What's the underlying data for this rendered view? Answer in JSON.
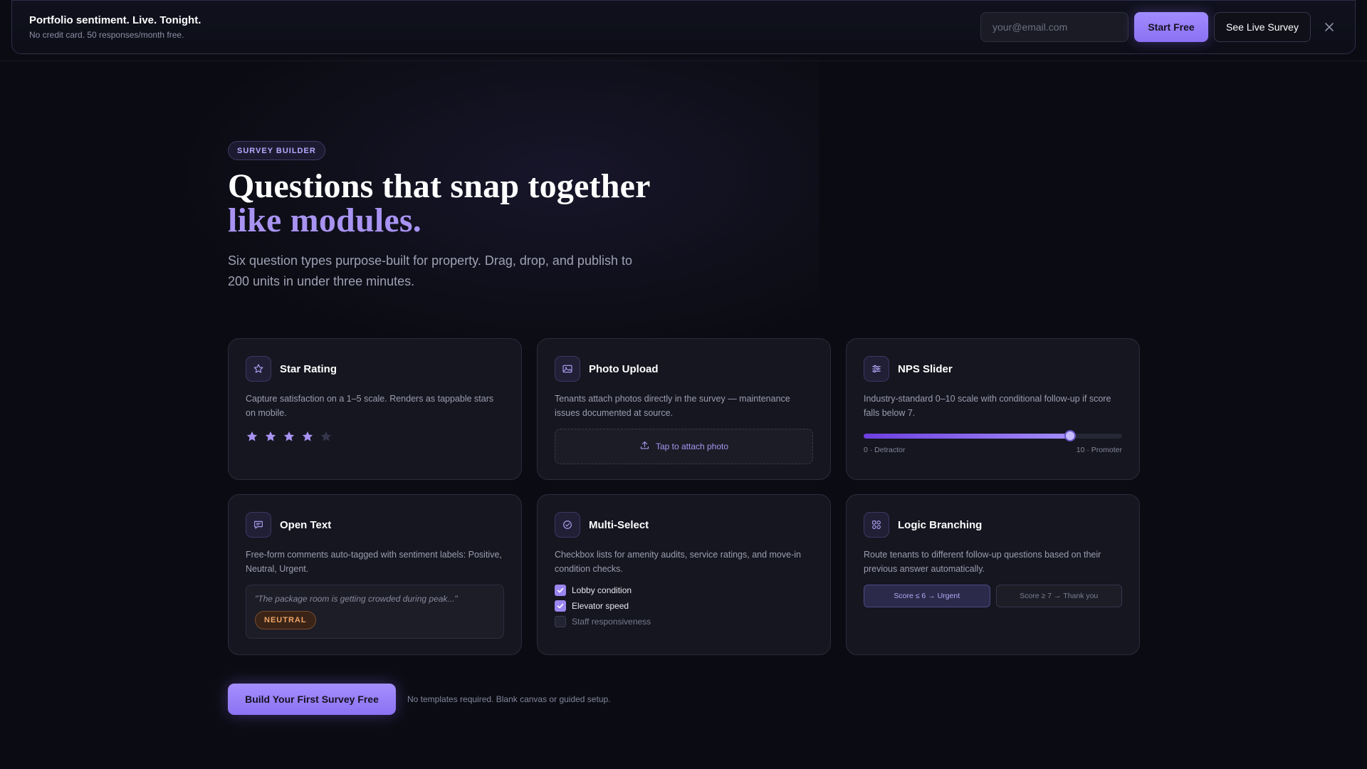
{
  "banner": {
    "title": "Portfolio sentiment. Live. Tonight.",
    "subtitle": "No credit card. 50 responses/month free.",
    "email_placeholder": "your@email.com",
    "start_label": "Start Free",
    "live_label": "See Live Survey",
    "close_icon": "close-icon"
  },
  "hero": {
    "badge": "SURVEY BUILDER",
    "headline_line1": "Questions that snap together",
    "headline_line2": "like modules.",
    "subhead": "Six question types purpose-built for property. Drag, drop, and publish to 200 units in under three minutes."
  },
  "cards": [
    {
      "icon": "star-icon",
      "title": "Star Rating",
      "desc": "Capture satisfaction on a 1–5 scale. Renders as tappable stars on mobile.",
      "rating": 4,
      "max_rating": 5
    },
    {
      "icon": "image-icon",
      "title": "Photo Upload",
      "desc": "Tenants attach photos directly in the survey — maintenance issues documented at source.",
      "upload_label": "Tap to attach photo",
      "upload_icon": "upload-icon"
    },
    {
      "icon": "sliders-icon",
      "title": "NPS Slider",
      "desc": "Industry-standard 0–10 scale with conditional follow-up if score falls below 7.",
      "value_fraction": 0.8,
      "min_label": "0 · Detractor",
      "max_label": "10 · Promoter"
    },
    {
      "icon": "chat-icon",
      "title": "Open Text",
      "desc": "Free-form comments auto-tagged with sentiment labels: Positive, Neutral, Urgent.",
      "quote": "\"The package room is getting crowded during peak...\"",
      "sentiment": "NEUTRAL"
    },
    {
      "icon": "check-circle-icon",
      "title": "Multi-Select",
      "desc": "Checkbox lists for amenity audits, service ratings, and move-in condition checks.",
      "options": [
        {
          "label": "Lobby condition",
          "checked": true
        },
        {
          "label": "Elevator speed",
          "checked": true
        },
        {
          "label": "Staff responsiveness",
          "checked": false
        }
      ]
    },
    {
      "icon": "grid-icon",
      "title": "Logic Branching",
      "desc": "Route tenants to different follow-up questions based on their previous answer automatically.",
      "branches": [
        "Score ≤ 6 → Urgent",
        "Score ≥ 7 → Thank you"
      ]
    }
  ],
  "cta": {
    "label": "Build Your First Survey Free",
    "note": "No templates required. Blank canvas or guided setup."
  },
  "colors": {
    "background": "#0b0c13",
    "accent": "#a893f2",
    "card": "#151620",
    "neutral_badge": "#f0a367"
  }
}
